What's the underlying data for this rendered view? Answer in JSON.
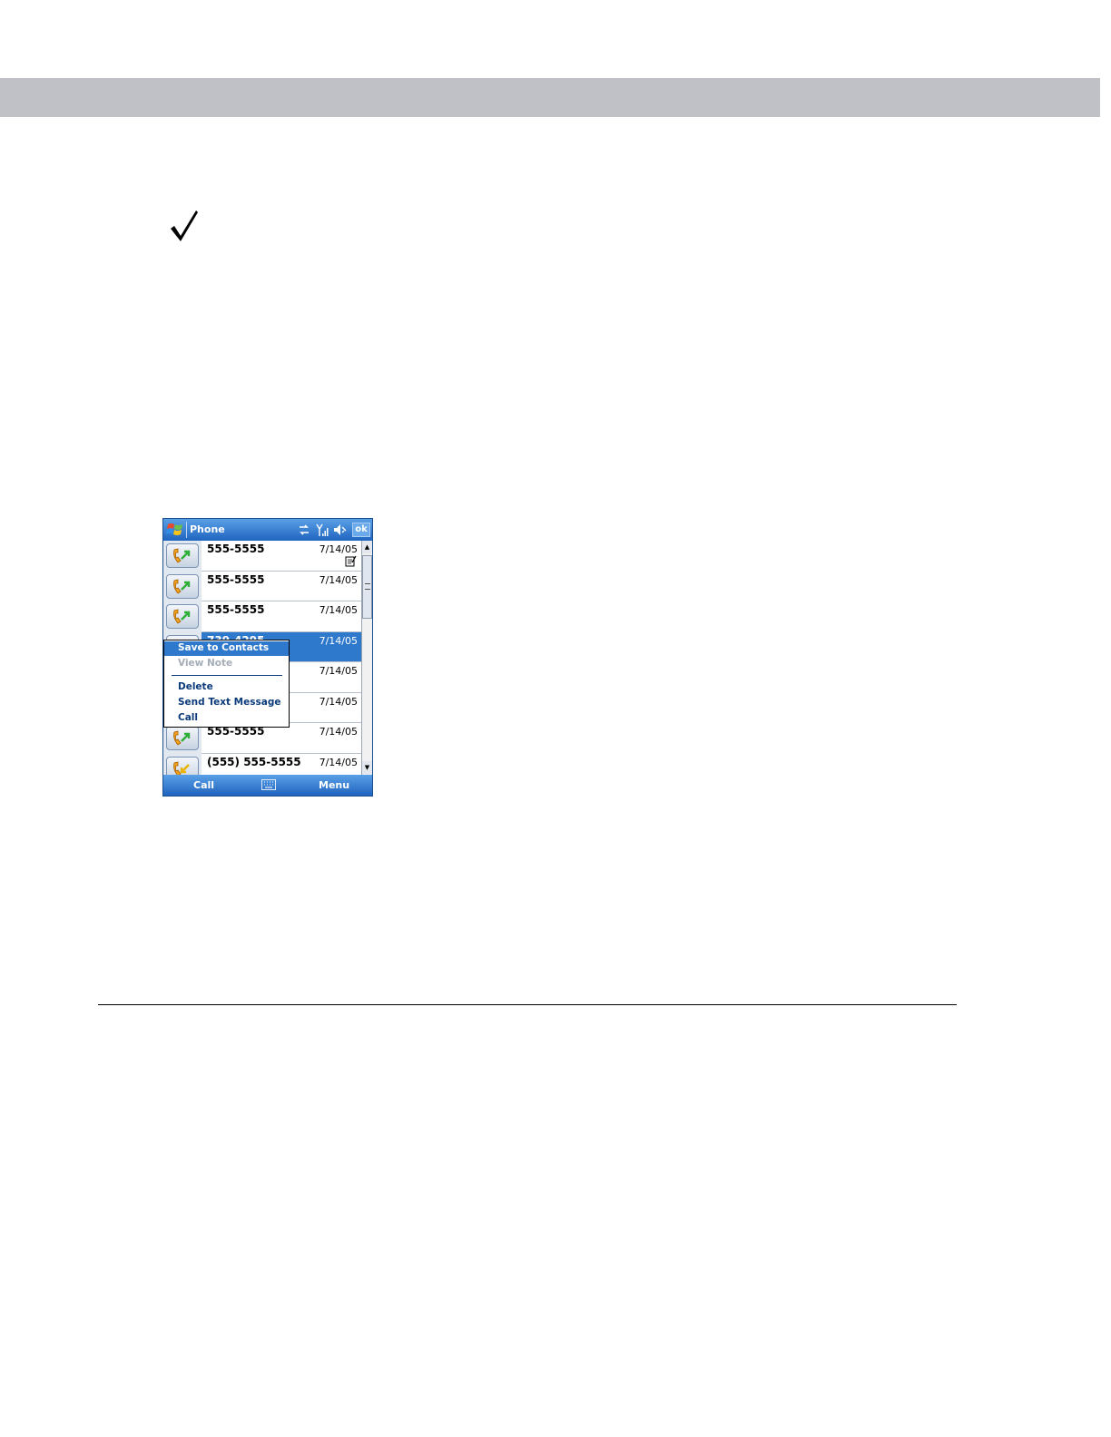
{
  "phone": {
    "title": "Phone",
    "ok_label": "ok",
    "call_history": [
      {
        "number": "555-5555",
        "date": "7/14/05",
        "type": "outgoing",
        "has_note": true
      },
      {
        "number": "555-5555",
        "date": "7/14/05",
        "type": "outgoing",
        "has_note": false
      },
      {
        "number": "555-5555",
        "date": "7/14/05",
        "type": "outgoing",
        "has_note": false
      },
      {
        "number": "739-4295",
        "date": "7/14/05",
        "type": "outgoing",
        "selected": true
      },
      {
        "number": "",
        "date": "7/14/05",
        "type": "outgoing"
      },
      {
        "number": "",
        "date": "7/14/05",
        "type": "outgoing"
      },
      {
        "number": "555-5555",
        "date": "7/14/05",
        "type": "outgoing"
      },
      {
        "number": "(555) 555-5555",
        "date": "7/14/05",
        "type": "incoming"
      }
    ],
    "context_menu": {
      "save_to_contacts": "Save to Contacts",
      "view_note": "View Note",
      "delete": "Delete",
      "send_text_message": "Send Text Message",
      "call": "Call"
    },
    "softkeys": {
      "left": "Call",
      "right": "Menu"
    },
    "colors": {
      "accent": "#2f79cc",
      "titlebar": "#1f64bf"
    }
  }
}
